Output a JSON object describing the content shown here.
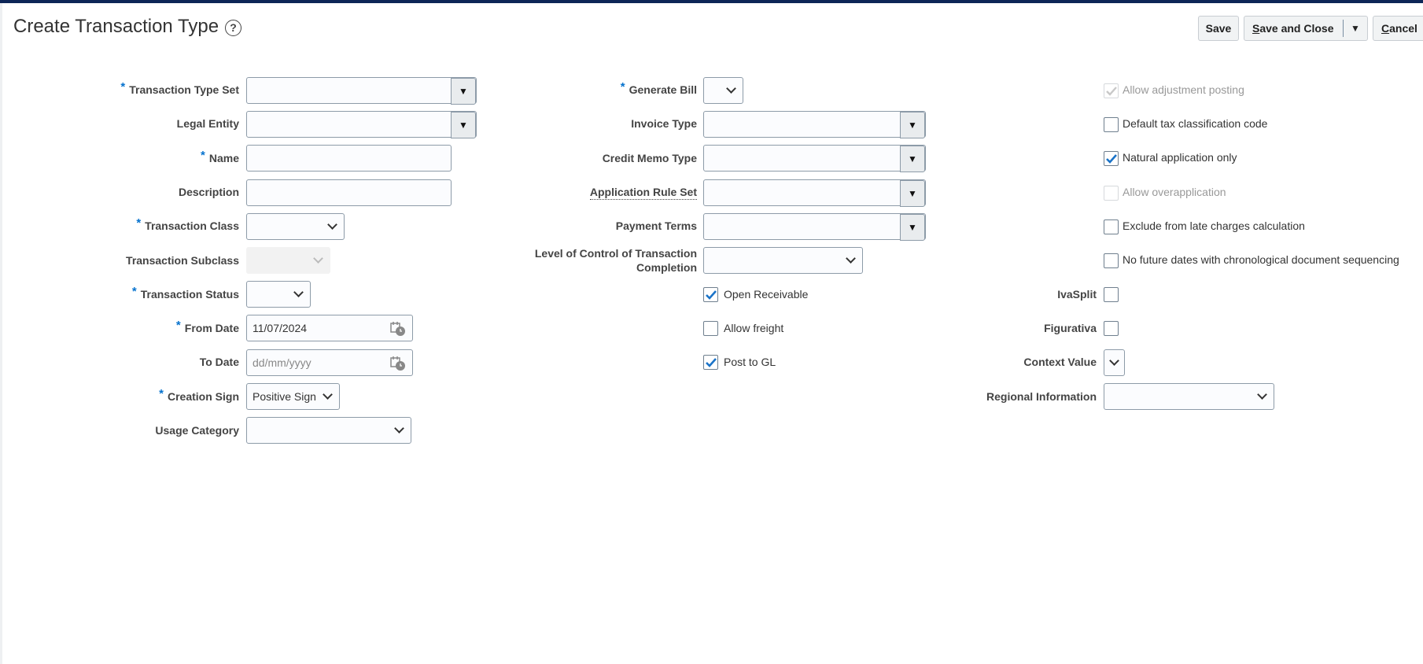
{
  "header": {
    "title": "Create Transaction Type",
    "save": "Save",
    "save_and_close_prefix": "S",
    "save_and_close_rest": "ave and Close",
    "cancel_prefix": "C",
    "cancel_rest": "ancel"
  },
  "col1": {
    "transaction_type_set": {
      "label": "Transaction Type Set",
      "value": ""
    },
    "legal_entity": {
      "label": "Legal Entity",
      "value": ""
    },
    "name": {
      "label": "Name",
      "value": ""
    },
    "description": {
      "label": "Description",
      "value": ""
    },
    "transaction_class": {
      "label": "Transaction Class",
      "value": ""
    },
    "transaction_subclass": {
      "label": "Transaction Subclass",
      "value": ""
    },
    "transaction_status": {
      "label": "Transaction Status",
      "value": ""
    },
    "from_date": {
      "label": "From Date",
      "value": "11/07/2024"
    },
    "to_date": {
      "label": "To Date",
      "placeholder": "dd/mm/yyyy"
    },
    "creation_sign": {
      "label": "Creation Sign",
      "value": "Positive Sign"
    },
    "usage_category": {
      "label": "Usage Category",
      "value": ""
    }
  },
  "col2": {
    "generate_bill": {
      "label": "Generate Bill",
      "value": ""
    },
    "invoice_type": {
      "label": "Invoice Type",
      "value": ""
    },
    "credit_memo_type": {
      "label": "Credit Memo Type",
      "value": ""
    },
    "application_rule_set": {
      "label": "Application Rule Set",
      "value": ""
    },
    "payment_terms": {
      "label": "Payment Terms",
      "value": ""
    },
    "level_of_control": {
      "label_line1": "Level of Control of Transaction",
      "label_line2": "Completion",
      "value": ""
    },
    "open_receivable": {
      "label": "Open Receivable",
      "checked": true
    },
    "allow_freight": {
      "label": "Allow freight",
      "checked": false
    },
    "post_to_gl": {
      "label": "Post to GL",
      "checked": true
    }
  },
  "col3": {
    "allow_adjustment_posting": {
      "label": "Allow adjustment posting",
      "checked": true,
      "disabled": true
    },
    "default_tax_classification": {
      "label": "Default tax classification code",
      "checked": false
    },
    "natural_application_only": {
      "label": "Natural application only",
      "checked": true
    },
    "allow_overapplication": {
      "label": "Allow overapplication",
      "checked": false,
      "disabled": true
    },
    "exclude_late_charges": {
      "label": "Exclude from late charges calculation",
      "checked": false
    },
    "no_future_dates": {
      "label": "No future dates with chronological document sequencing",
      "checked": false
    },
    "iva_split": {
      "label": "IvaSplit",
      "checked": false
    },
    "figurativa": {
      "label": "Figurativa",
      "checked": false
    },
    "context_value": {
      "label": "Context Value",
      "value": ""
    },
    "regional_information": {
      "label": "Regional Information",
      "value": ""
    }
  },
  "colors": {
    "accent": "#0572ce",
    "topbar": "#0d2657"
  }
}
